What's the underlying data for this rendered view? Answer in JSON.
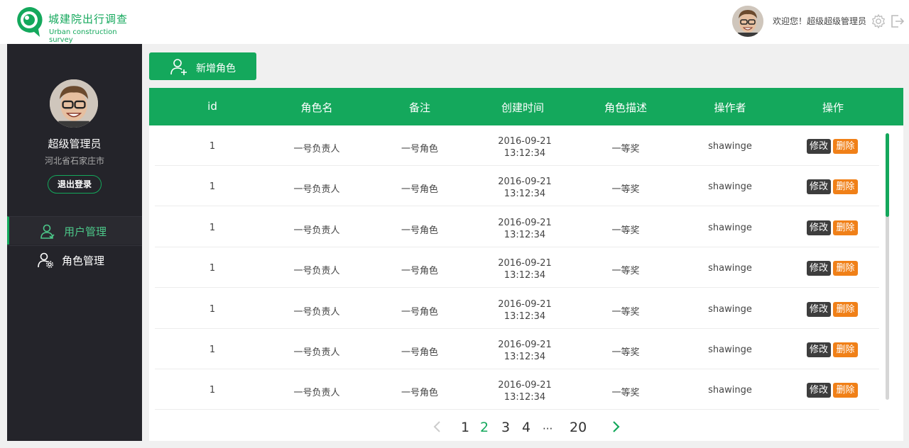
{
  "header": {
    "logo_title": "城建院出行调查",
    "logo_subtitle": "Urban construction survey",
    "welcome_text": "欢迎您！超级超级管理员"
  },
  "sidebar": {
    "user_name": "超级管理员",
    "location": "河北省石家庄市",
    "logout_label": "退出登录",
    "nav": [
      {
        "label": "用户管理",
        "icon": "user-icon",
        "active": true
      },
      {
        "label": "角色管理",
        "icon": "user-gear-icon",
        "active": false
      }
    ]
  },
  "main": {
    "add_button_label": "新增角色",
    "columns": [
      "id",
      "角色名",
      "备注",
      "创建时间",
      "角色描述",
      "操作者",
      "操作"
    ],
    "rows": [
      {
        "id": "1",
        "name": "一号负责人",
        "remark": "一号角色",
        "date": "2016-09-21",
        "time": "13:12:34",
        "desc": "一等奖",
        "operator": "shawinge"
      },
      {
        "id": "1",
        "name": "一号负责人",
        "remark": "一号角色",
        "date": "2016-09-21",
        "time": "13:12:34",
        "desc": "一等奖",
        "operator": "shawinge"
      },
      {
        "id": "1",
        "name": "一号负责人",
        "remark": "一号角色",
        "date": "2016-09-21",
        "time": "13:12:34",
        "desc": "一等奖",
        "operator": "shawinge"
      },
      {
        "id": "1",
        "name": "一号负责人",
        "remark": "一号角色",
        "date": "2016-09-21",
        "time": "13:12:34",
        "desc": "一等奖",
        "operator": "shawinge"
      },
      {
        "id": "1",
        "name": "一号负责人",
        "remark": "一号角色",
        "date": "2016-09-21",
        "time": "13:12:34",
        "desc": "一等奖",
        "operator": "shawinge"
      },
      {
        "id": "1",
        "name": "一号负责人",
        "remark": "一号角色",
        "date": "2016-09-21",
        "time": "13:12:34",
        "desc": "一等奖",
        "operator": "shawinge"
      },
      {
        "id": "1",
        "name": "一号负责人",
        "remark": "一号角色",
        "date": "2016-09-21",
        "time": "13:12:34",
        "desc": "一等奖",
        "operator": "shawinge"
      }
    ],
    "edit_label": "修改",
    "delete_label": "删除",
    "pagination": {
      "pages": [
        "1",
        "2",
        "3",
        "4",
        "···",
        "20"
      ],
      "current": "2"
    }
  },
  "colors": {
    "accent": "#14a85c",
    "sidebar_bg": "#24242a",
    "edit_button": "#3d3d3d",
    "delete_button": "#f08018"
  }
}
